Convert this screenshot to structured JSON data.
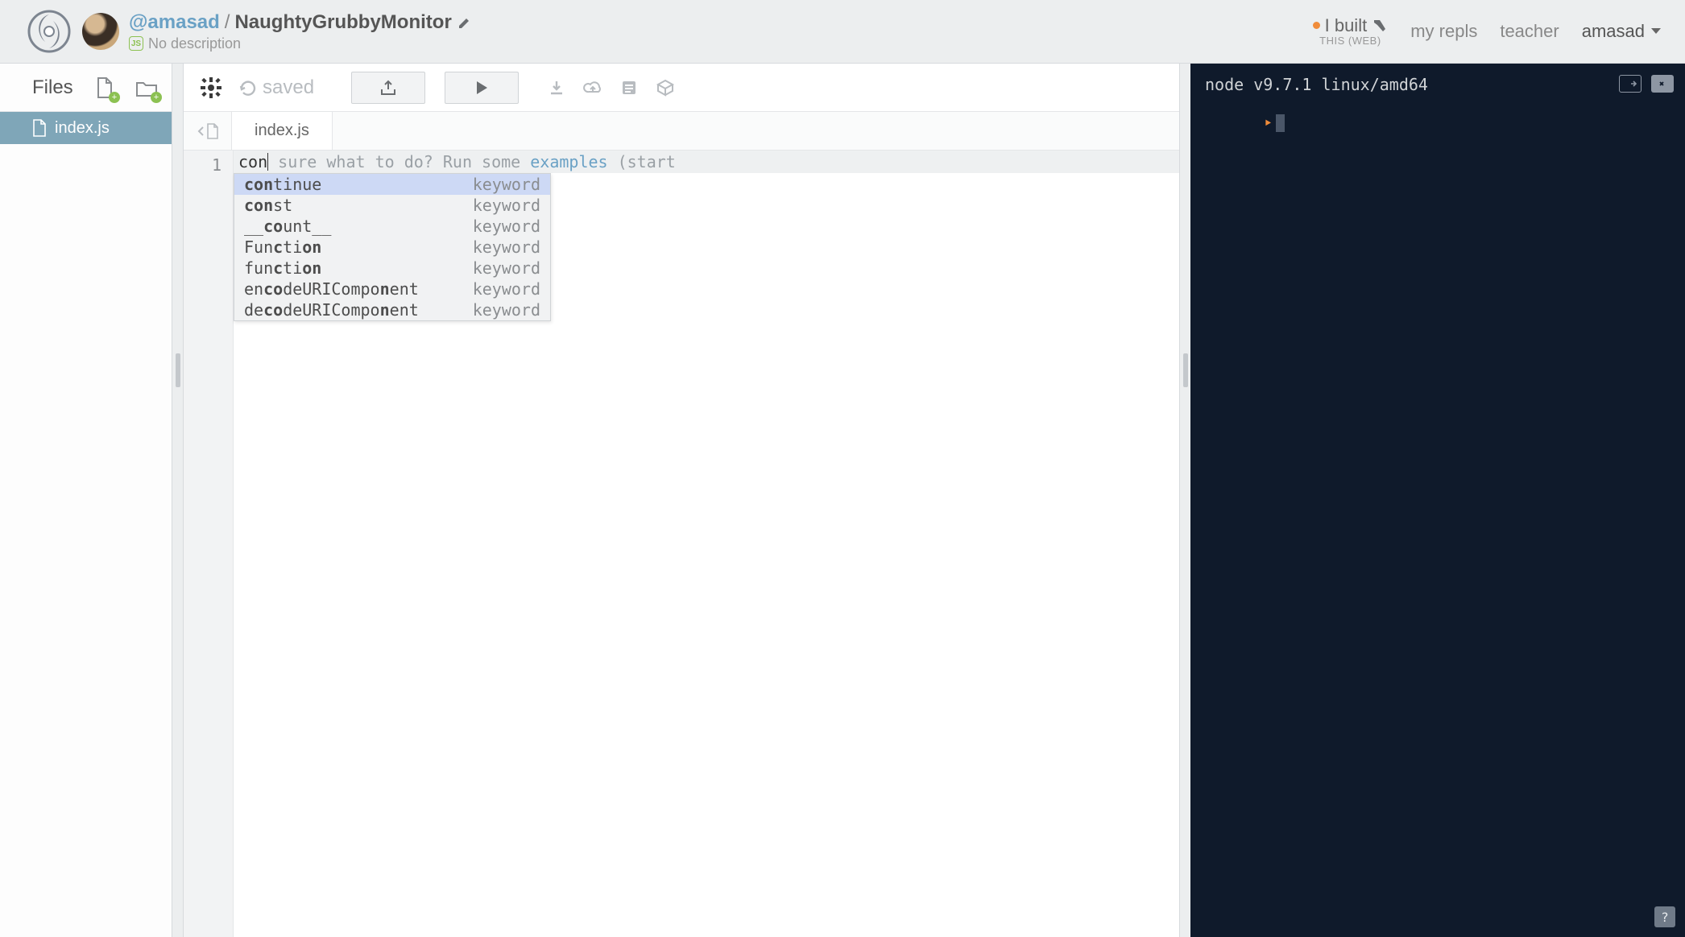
{
  "header": {
    "username": "@amasad",
    "separator": "/",
    "project": "NaughtyGrubbyMonitor",
    "description": "No description",
    "right": {
      "ibuilt_top": "I built",
      "ibuilt_sub": "THIS (WEB)",
      "my_repls": "my repls",
      "teacher": "teacher",
      "account": "amasad"
    }
  },
  "sidebar": {
    "title": "Files",
    "files": [
      {
        "name": "index.js"
      }
    ]
  },
  "toolbar": {
    "saved_label": "saved"
  },
  "editor": {
    "tab": "index.js",
    "line_number": "1",
    "typed": "con",
    "hint_before": " sure what to do? Run some ",
    "hint_link": "examples",
    "hint_after": " (start",
    "autocomplete": [
      {
        "text": "continue",
        "type": "keyword",
        "segments": [
          [
            "b",
            "con"
          ],
          [
            "",
            "tinue"
          ]
        ]
      },
      {
        "text": "const",
        "type": "keyword",
        "segments": [
          [
            "b",
            "con"
          ],
          [
            "",
            "st"
          ]
        ]
      },
      {
        "text": "__count__",
        "type": "keyword",
        "segments": [
          [
            "",
            "__"
          ],
          [
            "b",
            "co"
          ],
          [
            "",
            "unt__"
          ]
        ]
      },
      {
        "text": "Function",
        "type": "keyword",
        "segments": [
          [
            "",
            "Fun"
          ],
          [
            "b",
            "c"
          ],
          [
            "",
            "ti"
          ],
          [
            "b",
            "on"
          ]
        ]
      },
      {
        "text": "function",
        "type": "keyword",
        "segments": [
          [
            "",
            "fun"
          ],
          [
            "b",
            "c"
          ],
          [
            "",
            "ti"
          ],
          [
            "b",
            "on"
          ]
        ]
      },
      {
        "text": "encodeURIComponent",
        "type": "keyword",
        "segments": [
          [
            "",
            "en"
          ],
          [
            "b",
            "co"
          ],
          [
            "",
            "deURICompo"
          ],
          [
            "b",
            "n"
          ],
          [
            "",
            "ent"
          ]
        ]
      },
      {
        "text": "decodeURIComponent",
        "type": "keyword",
        "segments": [
          [
            "",
            "de"
          ],
          [
            "b",
            "co"
          ],
          [
            "",
            "deURICompo"
          ],
          [
            "b",
            "n"
          ],
          [
            "",
            "ent"
          ]
        ]
      }
    ]
  },
  "terminal": {
    "line1": "node v9.7.1 linux/amd64",
    "prompt": "‣"
  }
}
